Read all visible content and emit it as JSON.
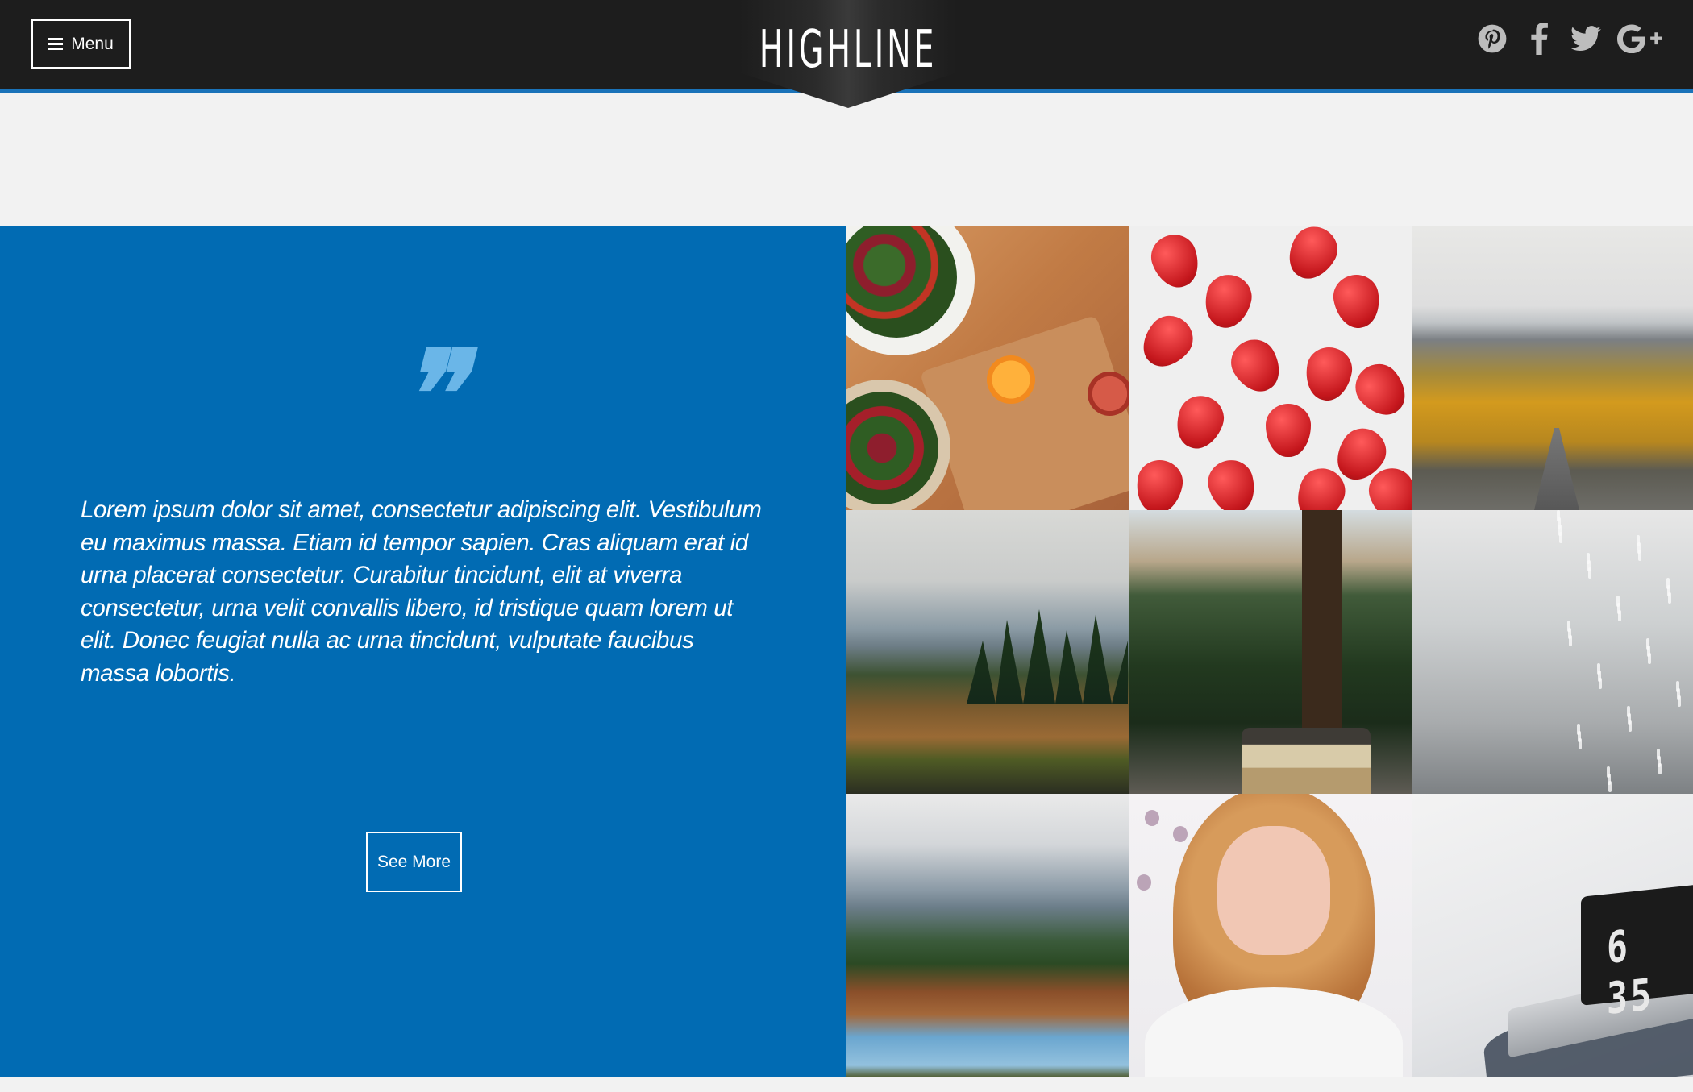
{
  "header": {
    "menu_label": "Menu",
    "logo_word1": "HIGH",
    "logo_word2": "LINE",
    "accent_color": "#1a73b9",
    "background_color": "#1d1d1d",
    "social": [
      {
        "name": "pinterest-icon"
      },
      {
        "name": "facebook-icon"
      },
      {
        "name": "twitter-icon"
      },
      {
        "name": "google-plus-icon"
      }
    ]
  },
  "quote_section": {
    "background_color": "#016bb3",
    "quote_mark": "❞",
    "text": "Lorem ipsum dolor sit amet, consectetur adipiscing elit. Vestibulum eu maximus massa. Etiam id tempor sapien. Cras aliquam erat id urna placerat consectetur. Curabitur tincidunt, elit at viverra consectetur, urna velit convallis libero, id tristique quam lorem ut elit. Donec feugiat nulla ac urna tincidunt, vulputate faucibus massa lobortis.",
    "button_label": "See More"
  },
  "gallery": {
    "tiles": [
      {
        "name": "salad-photo"
      },
      {
        "name": "strawberries-photo"
      },
      {
        "name": "mountain-road-photo"
      },
      {
        "name": "hiker-photo"
      },
      {
        "name": "forest-van-photo"
      },
      {
        "name": "rain-photo"
      },
      {
        "name": "mountain-lake-photo"
      },
      {
        "name": "woman-hands-photo"
      },
      {
        "name": "laptop-bed-photo"
      }
    ],
    "clock_text": "6 35"
  }
}
